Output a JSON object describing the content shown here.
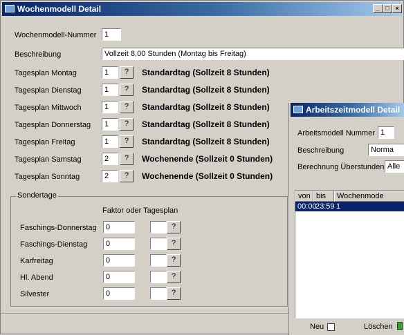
{
  "wochenmodell": {
    "title": "Wochenmodell Detail",
    "fields": {
      "nummer_label": "Wochenmodell-Nummer",
      "nummer_value": "1",
      "beschreibung_label": "Beschreibung",
      "beschreibung_value": "Vollzeit 8,00 Stunden (Montag bis Freitag)"
    },
    "days": [
      {
        "label": "Tagesplan Montag",
        "value": "1",
        "lookup": "?",
        "plan": "Standardtag (Sollzeit 8 Stunden)"
      },
      {
        "label": "Tagesplan Dienstag",
        "value": "1",
        "lookup": "?",
        "plan": "Standardtag (Sollzeit 8 Stunden)"
      },
      {
        "label": "Tagesplan Mittwoch",
        "value": "1",
        "lookup": "?",
        "plan": "Standardtag (Sollzeit 8 Stunden)"
      },
      {
        "label": "Tagesplan Donnerstag",
        "value": "1",
        "lookup": "?",
        "plan": "Standardtag (Sollzeit 8 Stunden)"
      },
      {
        "label": "Tagesplan Freitag",
        "value": "1",
        "lookup": "?",
        "plan": "Standardtag (Sollzeit 8 Stunden)"
      },
      {
        "label": "Tagesplan Samstag",
        "value": "2",
        "lookup": "?",
        "plan": "Wochenende (Sollzeit 0 Stunden)"
      },
      {
        "label": "Tagesplan Sonntag",
        "value": "2",
        "lookup": "?",
        "plan": "Wochenende (Sollzeit 0 Stunden)"
      }
    ],
    "sondertage": {
      "title": "Sondertage",
      "column_header": "Faktor oder Tagesplan",
      "rows": [
        {
          "label": "Faschings-Donnerstag",
          "factor": "0",
          "plan": "",
          "lookup": "?"
        },
        {
          "label": "Faschings-Dienstag",
          "factor": "0",
          "plan": "",
          "lookup": "?"
        },
        {
          "label": "Karfreitag",
          "factor": "0",
          "plan": "",
          "lookup": "?"
        },
        {
          "label": "Hl. Abend",
          "factor": "0",
          "plan": "",
          "lookup": "?"
        },
        {
          "label": "Silvester",
          "factor": "0",
          "plan": "",
          "lookup": "?"
        }
      ]
    }
  },
  "arbeitszeitmodell": {
    "title": "Arbeitszeitmodell Detail",
    "nummer_label": "Arbeitsmodell Nummer",
    "nummer_value": "1",
    "beschreibung_label": "Beschreibung",
    "beschreibung_value": "Norma",
    "berechnung_label": "Berechnung Überstunden",
    "berechnung_value": "Alle",
    "columns": [
      "von",
      "bis",
      "Wochenmode"
    ],
    "rows": [
      {
        "von": "00:00",
        "bis": "23:59",
        "modell": "1"
      }
    ],
    "new_label": "Neu",
    "delete_label": "Löschen"
  },
  "icons": [
    "window-icon",
    "minimize-icon",
    "maximize-icon",
    "close-icon",
    "trash-icon"
  ],
  "colors": {
    "titlebar": "#0a246a",
    "face": "#d4d0c8",
    "selection": "#0a246a"
  }
}
